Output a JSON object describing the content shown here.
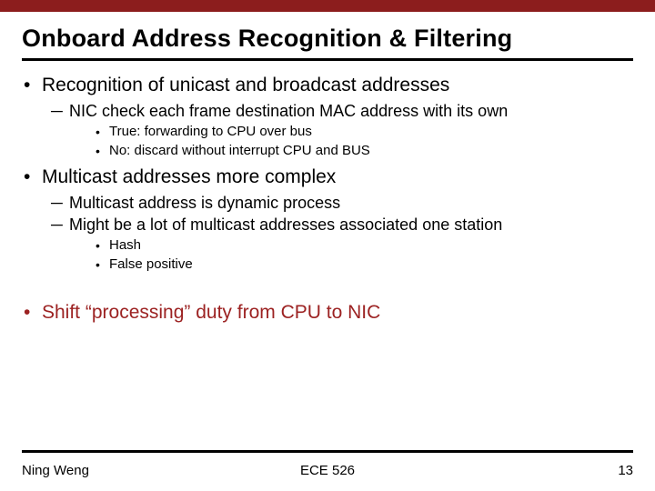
{
  "title": "Onboard Address Recognition & Filtering",
  "bullets": [
    {
      "text": "Recognition of unicast and broadcast addresses",
      "highlight": false,
      "children": [
        {
          "text": "NIC check each frame destination MAC address with its own",
          "children": [
            {
              "text": "True: forwarding to CPU over bus"
            },
            {
              "text": "No: discard without interrupt CPU and BUS"
            }
          ]
        }
      ]
    },
    {
      "text": "Multicast addresses more complex",
      "highlight": false,
      "children": [
        {
          "text": "Multicast address is dynamic process",
          "children": []
        },
        {
          "text": "Might be a lot of multicast addresses associated one station",
          "children": [
            {
              "text": "Hash"
            },
            {
              "text": "False positive"
            }
          ]
        }
      ]
    },
    {
      "text": "Shift “processing” duty from CPU to NIC",
      "highlight": true,
      "spacer_before": true,
      "children": []
    }
  ],
  "footer": {
    "author": "Ning Weng",
    "course": "ECE 526",
    "page": "13"
  },
  "glyphs": {
    "dot": "•",
    "dash": "─"
  }
}
